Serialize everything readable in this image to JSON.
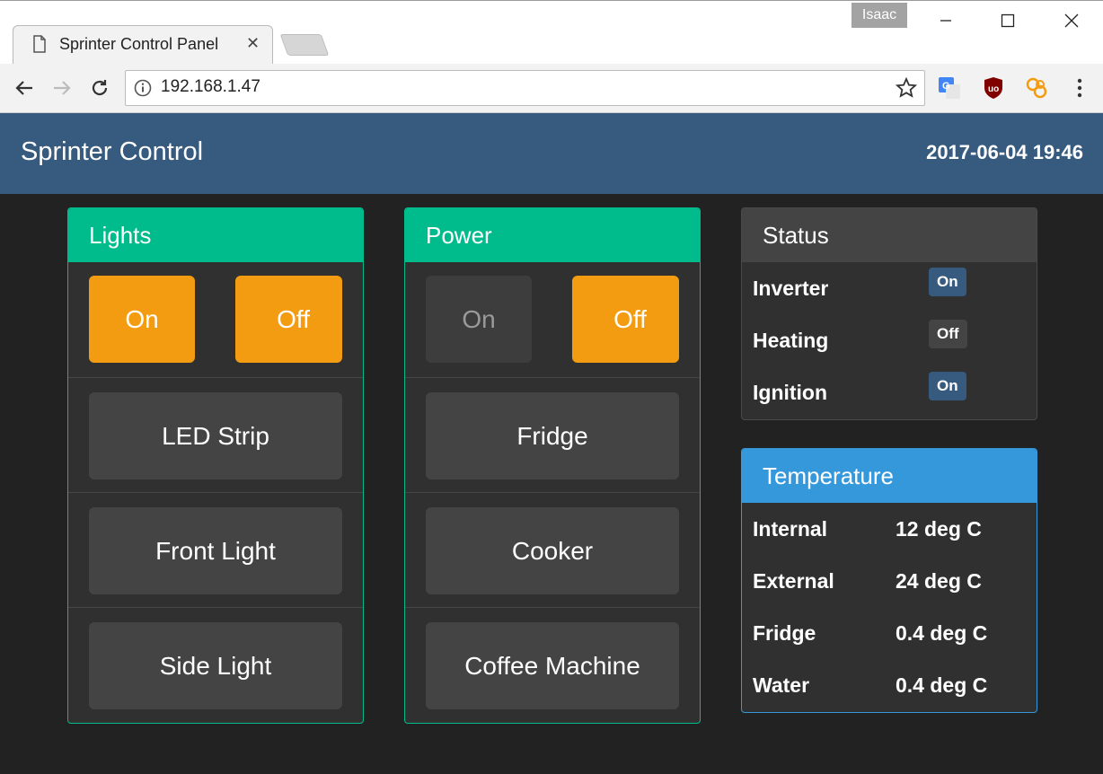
{
  "browser": {
    "tab_title": "Sprinter Control Panel",
    "tab_close": "✕",
    "profile_name": "Isaac",
    "url": "192.168.1.47"
  },
  "app": {
    "brand": "Sprinter Control",
    "datetime": "2017-06-04 19:46"
  },
  "lights": {
    "title": "Lights",
    "on_label": "On",
    "off_label": "Off",
    "items": [
      "LED Strip",
      "Front Light",
      "Side Light"
    ]
  },
  "power": {
    "title": "Power",
    "on_label": "On",
    "off_label": "Off",
    "items": [
      "Fridge",
      "Cooker",
      "Coffee Machine"
    ]
  },
  "status": {
    "title": "Status",
    "rows": [
      {
        "label": "Inverter",
        "value": "On"
      },
      {
        "label": "Heating",
        "value": "Off"
      },
      {
        "label": "Ignition",
        "value": "On"
      }
    ]
  },
  "temperature": {
    "title": "Temperature",
    "rows": [
      {
        "label": "Internal",
        "value": "12 deg C"
      },
      {
        "label": "External",
        "value": "24 deg C"
      },
      {
        "label": "Fridge",
        "value": "0.4 deg C"
      },
      {
        "label": "Water",
        "value": "0.4 deg C"
      }
    ]
  },
  "colors": {
    "header": "#375a7f",
    "success": "#00bc8c",
    "warning": "#f39c12",
    "info": "#3498db",
    "background": "#222222"
  },
  "icons": [
    "page-icon",
    "close-icon",
    "minimize-icon",
    "maximize-icon",
    "window-close-icon",
    "back-icon",
    "forward-icon",
    "reload-icon",
    "info-icon",
    "star-icon",
    "translate-icon",
    "ublock-icon",
    "extension-icon",
    "menu-icon"
  ]
}
